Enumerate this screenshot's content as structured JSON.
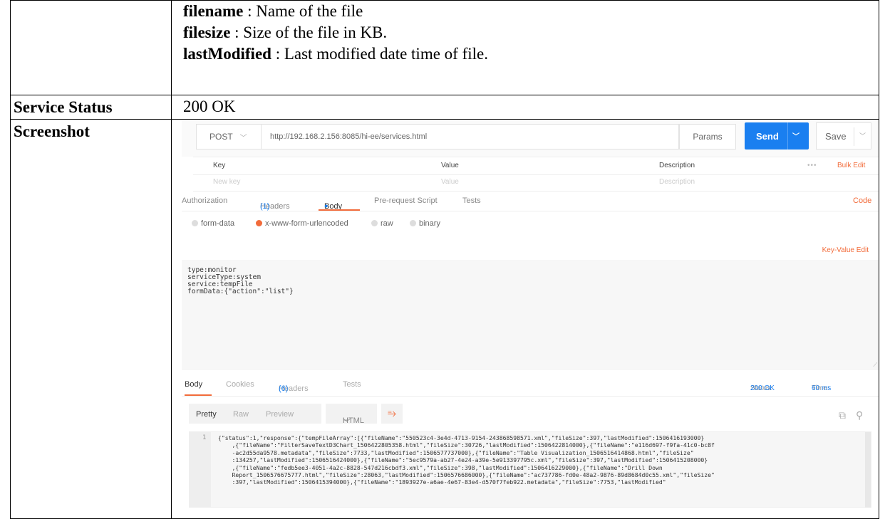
{
  "doc": {
    "fields": [
      {
        "name": "filename",
        "desc": " : Name of the file"
      },
      {
        "name": "filesize",
        "desc": " : Size of the file in KB."
      },
      {
        "name": "lastModified",
        "desc": " : Last modified date time of file."
      }
    ],
    "service_status_label": "Service Status",
    "service_status_value": "200 OK",
    "screenshot_label": "Screenshot"
  },
  "postman": {
    "method": "POST",
    "url": "http://192.168.2.156:8085/hi-ee/services.html",
    "params_label": "Params",
    "send_label": "Send",
    "save_label": "Save",
    "kv_headers": {
      "key": "Key",
      "value": "Value",
      "description": "Description",
      "more": "•••",
      "bulk_edit": "Bulk Edit"
    },
    "kv_placeholders": {
      "key": "New key",
      "value": "Value",
      "description": "Description"
    },
    "request_tabs": {
      "authorization": "Authorization",
      "headers": "Headers",
      "headers_count": "(1)",
      "body": "Body",
      "body_dot": "●",
      "prerequest": "Pre-request Script",
      "tests": "Tests",
      "code": "Code"
    },
    "body_types": {
      "form_data": "form-data",
      "urlencoded": "x-www-form-urlencoded",
      "raw": "raw",
      "binary": "binary"
    },
    "key_value_edit": "Key-Value Edit",
    "request_body": "type:monitor\nserviceType:system\nservice:tempFile\nformData:{\"action\":\"list\"}",
    "response_tabs": {
      "body": "Body",
      "cookies": "Cookies",
      "headers": "Headers",
      "headers_count": "(6)",
      "tests": "Tests",
      "status_label": "Status:",
      "status_value": "200 OK",
      "time_label": "Time:",
      "time_value": "60 ms"
    },
    "view_modes": {
      "pretty": "Pretty",
      "raw": "Raw",
      "preview": "Preview",
      "format": "HTML"
    },
    "response_line_no": "1",
    "response_text": "{\"status\":1,\"response\":{\"tempFileArray\":[{\"fileName\":\"550523c4-3e4d-4713-9154-243868598571.xml\",\"fileSize\":397,\"lastModified\":1506416193000}\n    ,{\"fileName\":\"FilterSaveTextD3Chart_1506422805358.html\",\"fileSize\":30726,\"lastModified\":1506422814000},{\"fileName\":\"e116d697-f9fa-41c0-bc8f\n    -ac2d55da9578.metadata\",\"fileSize\":7733,\"lastModified\":1506577737000},{\"fileName\":\"Table Visualization_1506516414868.html\",\"fileSize\"\n    :134257,\"lastModified\":1506516424000},{\"fileName\":\"5ec9579a-ab27-4e24-a39e-5e913397795c.xml\",\"fileSize\":397,\"lastModified\":1506415208000}\n    ,{\"fileName\":\"fedb5ee3-4051-4a2c-8828-547d216cbdf3.xml\",\"fileSize\":398,\"lastModified\":1506416229000},{\"fileName\":\"Drill Down\n    Report_1506576675777.html\",\"fileSize\":28063,\"lastModified\":1506576686000},{\"fileName\":\"ac737786-fd0e-48a2-9876-89d8684d0c55.xml\",\"fileSize\"\n    :397,\"lastModified\":1506415394000},{\"fileName\":\"1893927e-a6ae-4e67-83e4-d570f7feb922.metadata\",\"fileSize\":7753,\"lastModified\""
  }
}
